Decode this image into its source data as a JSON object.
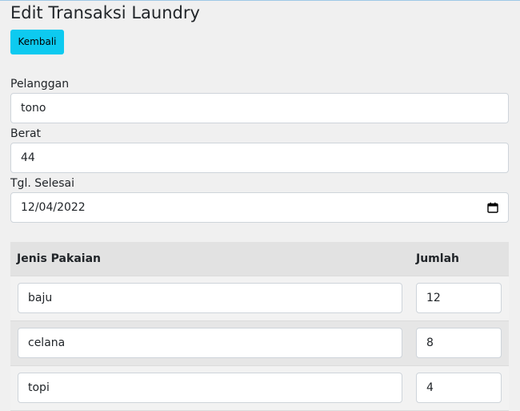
{
  "page": {
    "title": "Edit Transaksi Laundry",
    "back_label": "Kembali"
  },
  "form": {
    "pelanggan": {
      "label": "Pelanggan",
      "value": "tono"
    },
    "berat": {
      "label": "Berat",
      "value": "44"
    },
    "tgl_selesai": {
      "label": "Tgl. Selesai",
      "value": "12/04/2022",
      "icon": "calendar-icon"
    }
  },
  "table": {
    "headers": [
      "Jenis Pakaian",
      "Jumlah"
    ],
    "rows": [
      {
        "jenis": "baju",
        "jumlah": "12"
      },
      {
        "jenis": "celana",
        "jumlah": "8"
      },
      {
        "jenis": "topi",
        "jumlah": "4"
      }
    ]
  },
  "colors": {
    "accent": "#0dcaf0",
    "background": "#f0f0f0",
    "table_header": "#e2e2e2"
  }
}
